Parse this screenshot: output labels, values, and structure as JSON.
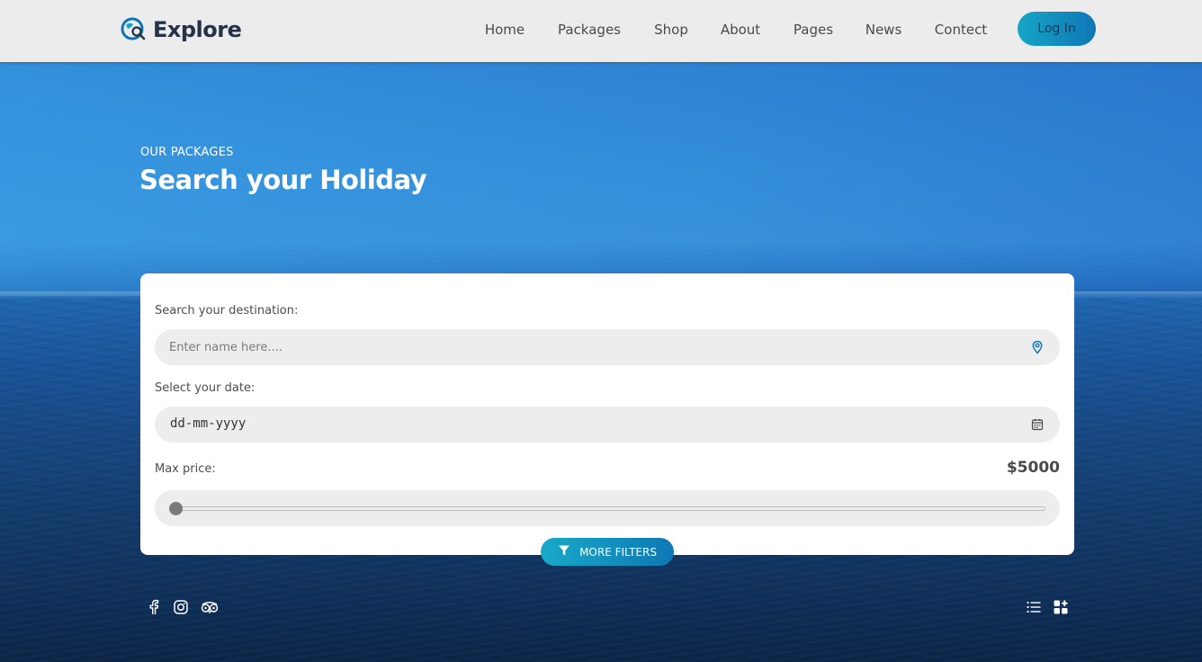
{
  "brand": {
    "name": "Explore"
  },
  "nav": {
    "items": [
      "Home",
      "Packages",
      "Shop",
      "About",
      "Pages",
      "News",
      "Contect"
    ],
    "login_label": "Log In"
  },
  "hero": {
    "eyebrow": "OUR PACKAGES",
    "title": "Search your Holiday"
  },
  "search": {
    "destination_label": "Search your destination:",
    "destination_placeholder": "Enter name here....",
    "date_label": "Select your date:",
    "date_value": "dd-mm-yyyy",
    "price_label": "Max price:",
    "price_value": "$5000",
    "price_slider_fraction": 0,
    "more_filters_label": "MORE FILTERS"
  },
  "icons": {
    "location": "map-pin-icon",
    "calendar": "calendar-icon",
    "filter": "filter-icon",
    "social": [
      "facebook-icon",
      "instagram-icon",
      "tripadvisor-icon"
    ],
    "view": [
      "list-view-icon",
      "grid-view-icon"
    ]
  },
  "colors": {
    "accent_start": "#16a6c6",
    "accent_end": "#0f76b5",
    "header_bg": "#ececec",
    "brand_text": "#253248"
  }
}
